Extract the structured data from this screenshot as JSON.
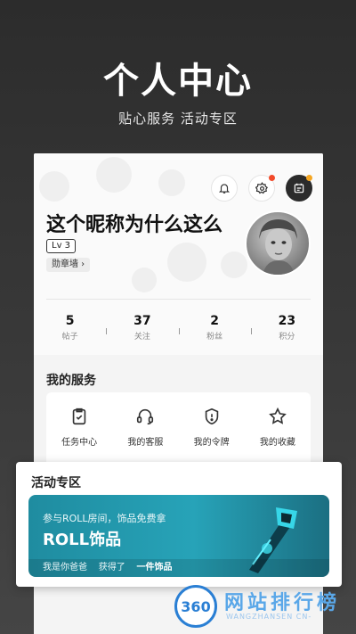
{
  "hero": {
    "title": "个人中心",
    "subtitle": "贴心服务 活动专区"
  },
  "profile": {
    "nickname": "这个昵称为什么这么",
    "level": "Lv 3",
    "badge_wall": "勋章墙 ›",
    "top_icons": [
      "bell-icon",
      "gear-icon",
      "calendar-sign-icon"
    ],
    "stats": [
      {
        "value": "5",
        "label": "帖子"
      },
      {
        "value": "37",
        "label": "关注"
      },
      {
        "value": "2",
        "label": "粉丝"
      },
      {
        "value": "23",
        "label": "积分"
      }
    ]
  },
  "services": {
    "title": "我的服务",
    "items": [
      {
        "label": "任务中心",
        "icon": "task-icon"
      },
      {
        "label": "我的客服",
        "icon": "headset-icon"
      },
      {
        "label": "我的令牌",
        "icon": "shield-token-icon"
      },
      {
        "label": "我的收藏",
        "icon": "star-icon"
      }
    ]
  },
  "activity": {
    "title": "活动专区",
    "banner_sub": "参与ROLL房间，饰品免费拿",
    "banner_main": "ROLL饰品",
    "footer_user": "我是你爸爸",
    "footer_got": "获得了",
    "footer_item": "一件饰品"
  },
  "watermark": {
    "badge": "360",
    "text": "网站排行榜",
    "small": "WANGZHANSEN CN-"
  },
  "colors": {
    "background": "#333333",
    "banner": "#27a3b8",
    "notify_dot": "#f24a2a"
  }
}
